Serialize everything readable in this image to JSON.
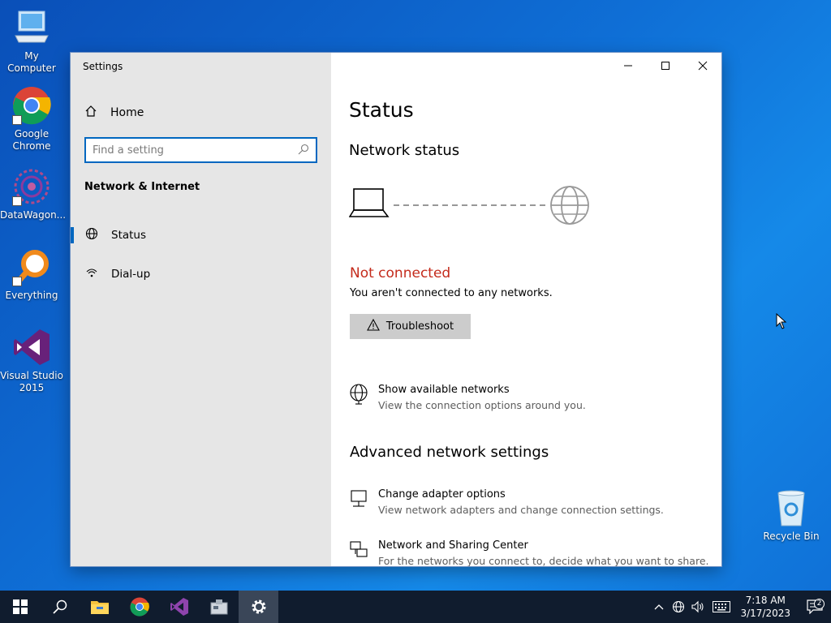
{
  "desktop": {
    "icons": [
      {
        "label": "My Computer"
      },
      {
        "label": "Google Chrome"
      },
      {
        "label": "DataWagon..."
      },
      {
        "label": "Everything"
      },
      {
        "label": "Visual Studio 2015"
      },
      {
        "label": "Recycle Bin"
      }
    ]
  },
  "window": {
    "title": "Settings",
    "sidebar": {
      "home": "Home",
      "search_placeholder": "Find a setting",
      "section": "Network & Internet",
      "items": [
        {
          "label": "Status",
          "icon": "globe-icon",
          "active": true
        },
        {
          "label": "Dial-up",
          "icon": "dialup-icon",
          "active": false
        }
      ]
    },
    "main": {
      "title": "Status",
      "network_status_heading": "Network status",
      "state": "Not connected",
      "state_desc": "You aren't connected to any networks.",
      "troubleshoot": "Troubleshoot",
      "show_networks": {
        "title": "Show available networks",
        "desc": "View the connection options around you."
      },
      "advanced_heading": "Advanced network settings",
      "adapter": {
        "title": "Change adapter options",
        "desc": "View network adapters and change connection settings."
      },
      "sharing": {
        "title": "Network and Sharing Center",
        "desc": "For the networks you connect to, decide what you want to share."
      }
    }
  },
  "taskbar": {
    "time": "7:18 AM",
    "date": "3/17/2023",
    "notifications": "2"
  },
  "colors": {
    "accent": "#0067c0",
    "error": "#c42b1c",
    "taskbar": "#101c2e"
  }
}
